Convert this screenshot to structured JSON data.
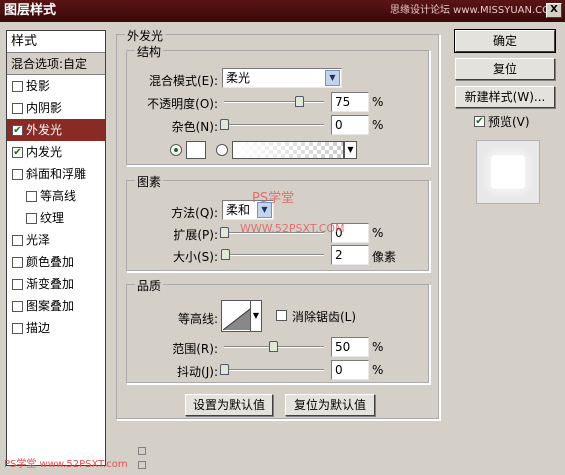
{
  "window": {
    "title": "图层样式",
    "watermark": "思缘设计论坛 www.MISSYUAN.COM",
    "close": "X"
  },
  "sidebar": {
    "header": "样式",
    "blend_options": "混合选项:自定",
    "items": [
      {
        "label": "投影",
        "checked": false
      },
      {
        "label": "内阴影",
        "checked": false
      },
      {
        "label": "外发光",
        "checked": true,
        "selected": true
      },
      {
        "label": "内发光",
        "checked": true
      },
      {
        "label": "斜面和浮雕",
        "checked": false
      },
      {
        "label": "等高线",
        "checked": false,
        "sub": true
      },
      {
        "label": "纹理",
        "checked": false,
        "sub": true
      },
      {
        "label": "光泽",
        "checked": false
      },
      {
        "label": "颜色叠加",
        "checked": false
      },
      {
        "label": "渐变叠加",
        "checked": false
      },
      {
        "label": "图案叠加",
        "checked": false
      },
      {
        "label": "描边",
        "checked": false
      }
    ]
  },
  "panel": {
    "title": "外发光",
    "structure": {
      "legend": "结构",
      "blend_mode_label": "混合模式(E):",
      "blend_mode_value": "柔光",
      "opacity_label": "不透明度(O):",
      "opacity_value": "75",
      "noise_label": "杂色(N):",
      "noise_value": "0",
      "percent": "%"
    },
    "elements": {
      "legend": "图素",
      "method_label": "方法(Q):",
      "method_value": "柔和",
      "spread_label": "扩展(P):",
      "spread_value": "0",
      "size_label": "大小(S):",
      "size_value": "2",
      "size_unit": "像素"
    },
    "quality": {
      "legend": "品质",
      "contour_label": "等高线:",
      "antialias_label": "消除锯齿(L)",
      "range_label": "范围(R):",
      "range_value": "50",
      "jitter_label": "抖动(J):",
      "jitter_value": "0"
    },
    "make_default": "设置为默认值",
    "reset_default": "复位为默认值"
  },
  "buttons": {
    "ok": "确定",
    "reset": "复位",
    "new_style": "新建样式(W)...",
    "preview": "预览(V)"
  },
  "watermarks": {
    "center_cn": "PS学堂",
    "center_url": "WWW.52PSXT.COM",
    "bottom": "PS学堂 www.52PSXT.com"
  }
}
